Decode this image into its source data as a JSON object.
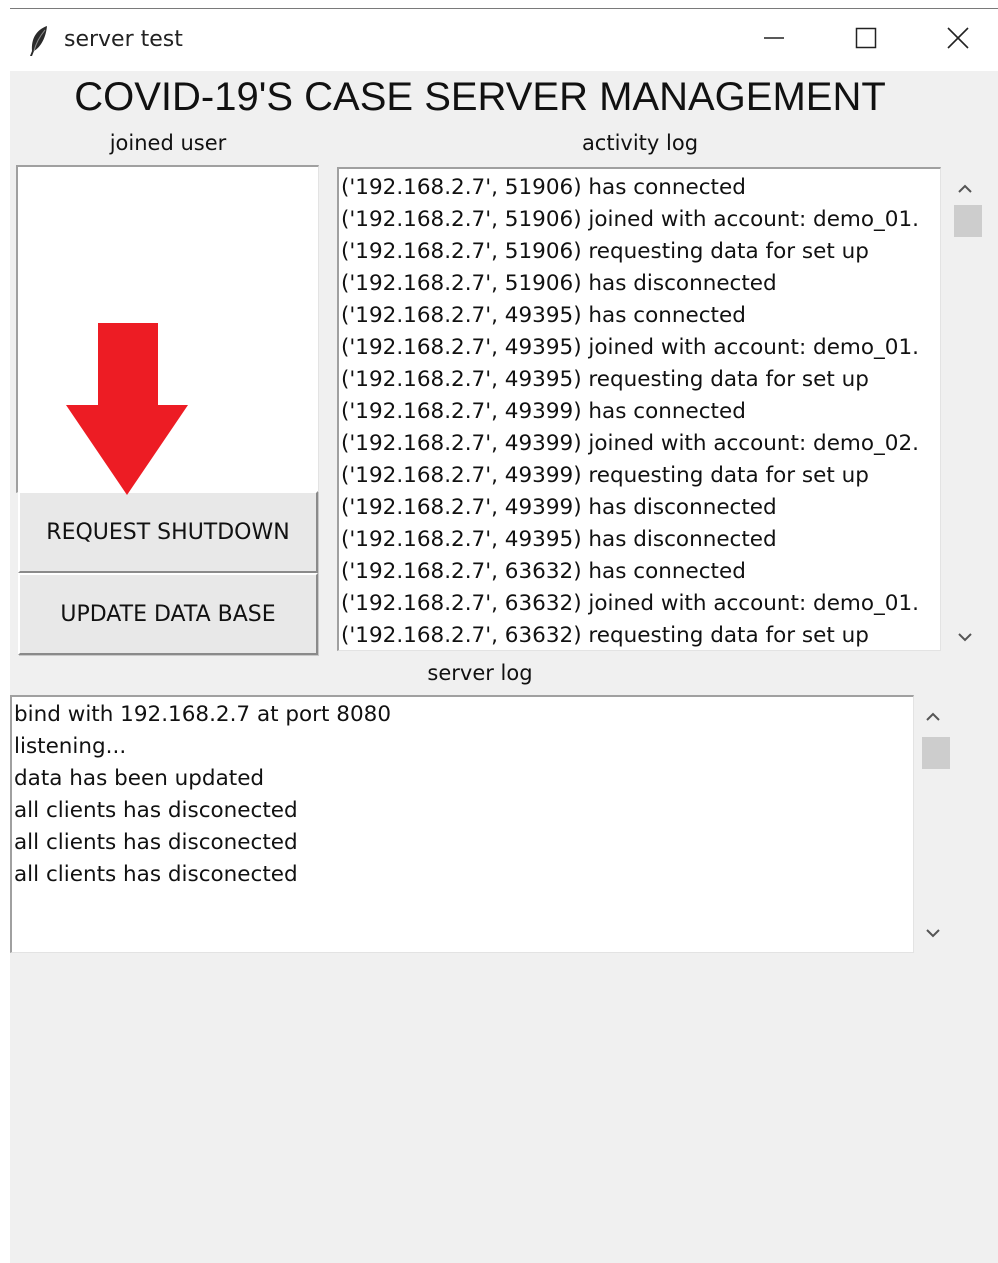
{
  "window": {
    "title": "server test",
    "app_icon": "feather-icon",
    "controls": [
      "minimize-icon",
      "maximize-icon",
      "close-icon"
    ]
  },
  "heading": "COVID-19'S CASE SERVER MANAGEMENT",
  "joined_user": {
    "label": "joined user",
    "items": []
  },
  "activity_log": {
    "label": "activity log",
    "lines": [
      "('192.168.2.7', 51906) has connected",
      "('192.168.2.7', 51906) joined with account: demo_01.",
      "('192.168.2.7', 51906) requesting data for set up",
      "('192.168.2.7', 51906) has disconnected",
      "('192.168.2.7', 49395) has connected",
      "('192.168.2.7', 49395) joined with account: demo_01.",
      "('192.168.2.7', 49395) requesting data for set up",
      "('192.168.2.7', 49399) has connected",
      "('192.168.2.7', 49399) joined with account: demo_02.",
      "('192.168.2.7', 49399) requesting data for set up",
      "('192.168.2.7', 49399) has disconnected",
      "('192.168.2.7', 49395) has disconnected",
      "('192.168.2.7', 63632) has connected",
      "('192.168.2.7', 63632) joined with account: demo_01.",
      "('192.168.2.7', 63632) requesting data for set up"
    ]
  },
  "buttons": {
    "shutdown": "REQUEST SHUTDOWN",
    "update": "UPDATE DATA BASE"
  },
  "server_log": {
    "label": "server log",
    "lines": [
      "bind with 192.168.2.7 at port 8080",
      "listening...",
      "data has been updated",
      "all clients has disconected",
      "all clients has disconected",
      "all clients has disconected"
    ]
  },
  "annotation": {
    "icon": "red-down-arrow-icon",
    "color": "#ed1c24"
  }
}
